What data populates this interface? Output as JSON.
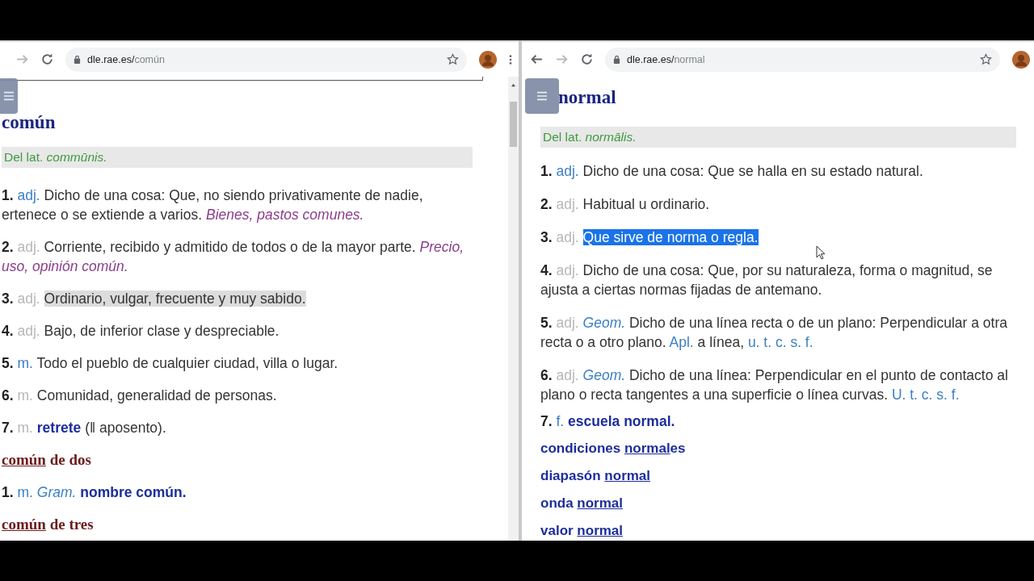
{
  "windows": [
    {
      "url_domain": "dle.rae.es/",
      "url_path": "común",
      "has_menu_dots": true,
      "has_scrollbar": true,
      "has_back": false,
      "title": "común",
      "etymology": "Del lat. *commūnis.*",
      "blocks": [
        {
          "kind": "sense",
          "parts": [
            {
              "kind": "num",
              "text": "1."
            },
            {
              "kind": "abbr",
              "text": "adj."
            },
            {
              "kind": "text",
              "text": "Dicho de una cosa: Que, no siendo privativamente de nadie, ertenece o se extiende a varios."
            },
            {
              "kind": "example",
              "text": "Bienes, pastos comunes."
            }
          ]
        },
        {
          "kind": "sense",
          "parts": [
            {
              "kind": "num",
              "text": "2."
            },
            {
              "kind": "abbr_faded",
              "text": "adj."
            },
            {
              "kind": "text",
              "text": "Corriente, recibido y admitido de todos o de la mayor parte."
            },
            {
              "kind": "example",
              "text": "Precio, uso, opinión común."
            }
          ]
        },
        {
          "kind": "sense",
          "parts": [
            {
              "kind": "num",
              "text": "3."
            },
            {
              "kind": "abbr_faded",
              "text": "adj."
            },
            {
              "kind": "marked",
              "text": "Ordinario, vulgar, frecuente y muy sabido."
            }
          ]
        },
        {
          "kind": "sense",
          "parts": [
            {
              "kind": "num",
              "text": "4."
            },
            {
              "kind": "abbr_faded",
              "text": "adj."
            },
            {
              "kind": "text",
              "text": "Bajo, de inferior clase y despreciable."
            }
          ]
        },
        {
          "kind": "sense",
          "parts": [
            {
              "kind": "num",
              "text": "5."
            },
            {
              "kind": "abbr",
              "text": "m."
            },
            {
              "kind": "text",
              "text": "Todo el pueblo de cualquier ciudad, villa o lugar."
            }
          ]
        },
        {
          "kind": "sense",
          "parts": [
            {
              "kind": "num",
              "text": "6."
            },
            {
              "kind": "abbr_faded",
              "text": "m."
            },
            {
              "kind": "text",
              "text": "Comunidad, generalidad de personas."
            }
          ]
        },
        {
          "kind": "sense",
          "parts": [
            {
              "kind": "num",
              "text": "7."
            },
            {
              "kind": "abbr_faded",
              "text": "m."
            },
            {
              "kind": "link",
              "text": "retrete"
            },
            {
              "kind": "text",
              "text": "(ǁ aposento)."
            }
          ]
        },
        {
          "kind": "subhead",
          "parts": [
            {
              "kind": "head_ul",
              "text": "común"
            },
            {
              "kind": "head",
              "text": "de dos"
            }
          ]
        },
        {
          "kind": "sense",
          "parts": [
            {
              "kind": "num",
              "text": "1."
            },
            {
              "kind": "abbr",
              "text": "m."
            },
            {
              "kind": "field",
              "text": "Gram."
            },
            {
              "kind": "link",
              "text": "nombre común."
            }
          ]
        },
        {
          "kind": "subhead",
          "parts": [
            {
              "kind": "head_ul",
              "text": "común"
            },
            {
              "kind": "head",
              "text": "de tres"
            }
          ]
        }
      ]
    },
    {
      "url_domain": "dle.rae.es/",
      "url_path": "normal",
      "has_menu_dots": false,
      "has_scrollbar": false,
      "has_back": true,
      "title": "normal",
      "etymology": "Del lat. *normālis.*",
      "blocks": [
        {
          "kind": "sense",
          "parts": [
            {
              "kind": "num",
              "text": "1."
            },
            {
              "kind": "abbr",
              "text": "adj."
            },
            {
              "kind": "text",
              "text": "Dicho de una cosa: Que se halla en su estado natural."
            }
          ]
        },
        {
          "kind": "sense",
          "parts": [
            {
              "kind": "num",
              "text": "2."
            },
            {
              "kind": "abbr_faded",
              "text": "adj."
            },
            {
              "kind": "text",
              "text": "Habitual u ordinario."
            }
          ]
        },
        {
          "kind": "sense",
          "parts": [
            {
              "kind": "num",
              "text": "3."
            },
            {
              "kind": "abbr_faded",
              "text": "adj."
            },
            {
              "kind": "selected",
              "text": "Que sirve de norma o regla."
            }
          ]
        },
        {
          "kind": "sense",
          "parts": [
            {
              "kind": "num",
              "text": "4."
            },
            {
              "kind": "abbr_faded",
              "text": "adj."
            },
            {
              "kind": "text",
              "text": "Dicho de una cosa: Que, por su naturaleza, forma o magnitud, se ajusta a ciertas normas fijadas de antemano."
            }
          ]
        },
        {
          "kind": "sense",
          "parts": [
            {
              "kind": "num",
              "text": "5."
            },
            {
              "kind": "abbr_faded",
              "text": "adj."
            },
            {
              "kind": "field",
              "text": "Geom."
            },
            {
              "kind": "text",
              "text": "Dicho de una línea recta o de un plano: Perpendicular a otra recta o a otro plano."
            },
            {
              "kind": "abbr",
              "text": "Apl."
            },
            {
              "kind": "text",
              "text": "a línea,"
            },
            {
              "kind": "abbr",
              "text": "u. t. c. s. f."
            }
          ]
        },
        {
          "kind": "sense",
          "parts": [
            {
              "kind": "num",
              "text": "6."
            },
            {
              "kind": "abbr_faded",
              "text": "adj."
            },
            {
              "kind": "field",
              "text": "Geom."
            },
            {
              "kind": "text",
              "text": "Dicho de una línea: Perpendicular en el punto de contacto al plano o recta tangentes a una superficie o línea curvas."
            },
            {
              "kind": "abbr",
              "text": "U. t. c. s. f."
            }
          ]
        },
        {
          "kind": "sense_tight",
          "parts": [
            {
              "kind": "num",
              "text": "7."
            },
            {
              "kind": "abbr",
              "text": "f."
            },
            {
              "kind": "link",
              "text": "escuela normal."
            }
          ]
        },
        {
          "kind": "phrase",
          "parts": [
            {
              "kind": "phrase",
              "text": "condiciones "
            },
            {
              "kind": "phrase_ul",
              "text": "normal"
            },
            {
              "kind": "phrase",
              "text": "es"
            }
          ]
        },
        {
          "kind": "phrase",
          "parts": [
            {
              "kind": "phrase",
              "text": "diapasón "
            },
            {
              "kind": "phrase_ul",
              "text": "normal"
            }
          ]
        },
        {
          "kind": "phrase",
          "parts": [
            {
              "kind": "phrase",
              "text": "onda "
            },
            {
              "kind": "phrase_ul",
              "text": "normal"
            }
          ]
        },
        {
          "kind": "phrase",
          "parts": [
            {
              "kind": "phrase",
              "text": "valor "
            },
            {
              "kind": "phrase_ul",
              "text": "normal"
            }
          ]
        }
      ]
    }
  ]
}
